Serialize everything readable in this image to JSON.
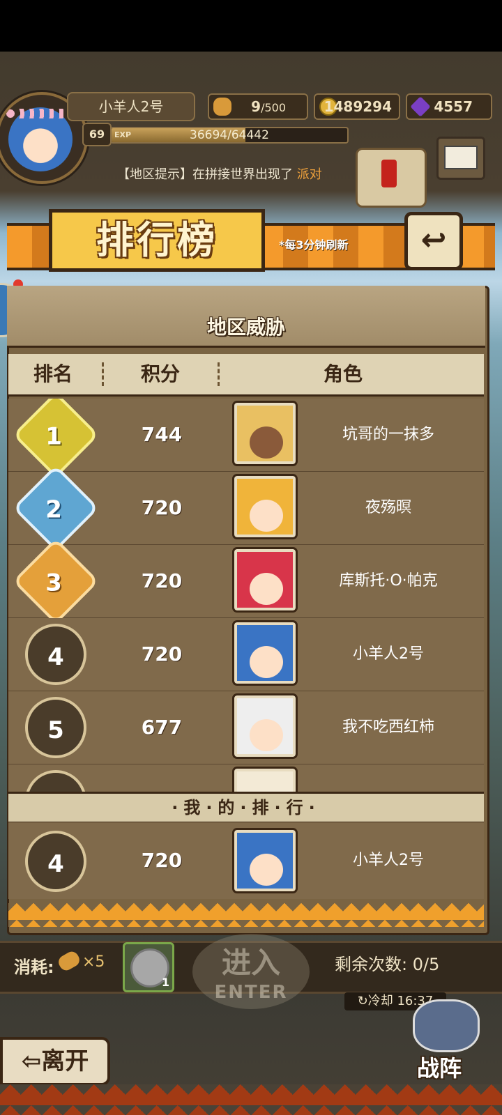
{
  "hud": {
    "player_name": "小羊人2号",
    "stamina": "9",
    "stamina_max": "/500",
    "gold": "1489294",
    "gems": "4557",
    "level": "69",
    "exp_label": "EXP",
    "exp": "36694/64442",
    "exp_fraction": 0.569,
    "ticker_text": "【地区提示】在拼接世界出现了 ",
    "ticker_highlight": "派对"
  },
  "banner": {
    "title": "排行榜",
    "subtitle": "*每3分钟刷新",
    "back_icon": "return-icon"
  },
  "panel": {
    "title": "地区威胁",
    "columns": {
      "rank": "排名",
      "score": "积分",
      "role": "角色"
    }
  },
  "rows": [
    {
      "rank": "1",
      "score": "744",
      "name": "坑哥的一抹多",
      "badge": "gold",
      "hair": "#e9c062",
      "skin": "#8a5a3a"
    },
    {
      "rank": "2",
      "score": "720",
      "name": "夜殇暝",
      "badge": "silver",
      "hair": "#f0b43a",
      "skin": "#fde0c7"
    },
    {
      "rank": "3",
      "score": "720",
      "name": "库斯托·O·帕克",
      "badge": "bronze",
      "hair": "#d8354a",
      "skin": "#fde0c7"
    },
    {
      "rank": "4",
      "score": "720",
      "name": "小羊人2号",
      "badge": "plain",
      "hair": "#3a74c4",
      "skin": "#fde0c7"
    },
    {
      "rank": "5",
      "score": "677",
      "name": "我不吃西红柿",
      "badge": "plain",
      "hair": "#eeeeee",
      "skin": "#fde0c7"
    },
    {
      "rank": "",
      "score": "",
      "name": "",
      "badge": "plain",
      "hair": "#f3ead6",
      "skin": "#fde0c7"
    }
  ],
  "my_rank": {
    "separator": "·我·的·排·行·",
    "rank": "4",
    "score": "720",
    "name": "小羊人2号",
    "hair": "#3a74c4",
    "skin": "#fde0c7"
  },
  "bottom": {
    "cost_label": "消耗:",
    "cost_value": "×5",
    "ticket_count": "1",
    "enter_zh": "进入",
    "enter_en": "ENTER",
    "remaining": "剩余次数: 0/5",
    "cooldown": "↻冷却 16:37",
    "leave": "⇦离开",
    "formation": "战阵"
  },
  "colors": {
    "banner_orange": "#f49a2c",
    "panel_brown": "#7a6443",
    "gold_coin": "#e2b43c",
    "gem_purple": "#7a3fc4"
  }
}
